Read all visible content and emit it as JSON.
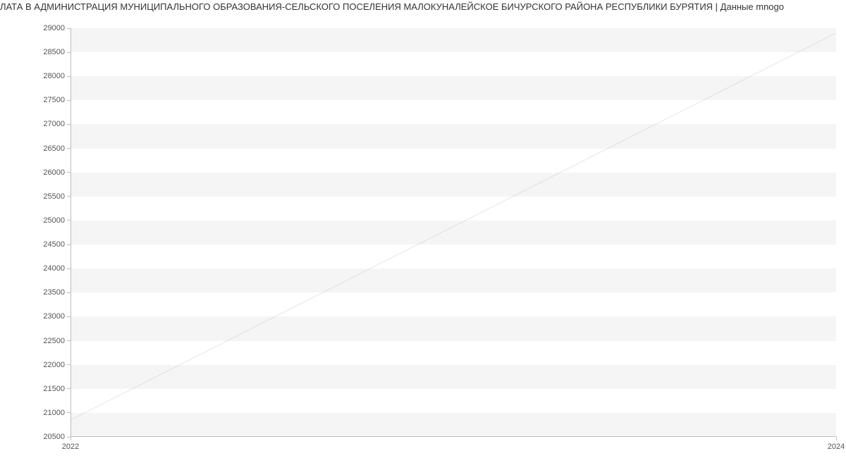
{
  "title": "ЛАТА В АДМИНИСТРАЦИЯ МУНИЦИПАЛЬНОГО ОБРАЗОВАНИЯ-СЕЛЬСКОГО ПОСЕЛЕНИЯ МАЛОКУНАЛЕЙСКОЕ БИЧУРСКОГО РАЙОНА РЕСПУБЛИКИ БУРЯТИЯ | Данные mnogo",
  "chart_data": {
    "type": "line",
    "x": [
      2022,
      2024
    ],
    "values": [
      20850,
      28900
    ],
    "title": "ЛАТА В АДМИНИСТРАЦИЯ МУНИЦИПАЛЬНОГО ОБРАЗОВАНИЯ-СЕЛЬСКОГО ПОСЕЛЕНИЯ МАЛОКУНАЛЕЙСКОЕ БИЧУРСКОГО РАЙОНА РЕСПУБЛИКИ БУРЯТИЯ | Данные mnogo",
    "xlabel": "",
    "ylabel": "",
    "ylim": [
      20500,
      29000
    ],
    "xlim": [
      2022,
      2024
    ],
    "y_ticks": [
      20500,
      21000,
      21500,
      22000,
      22500,
      23000,
      23500,
      24000,
      24500,
      25000,
      25500,
      26000,
      26500,
      27000,
      27500,
      28000,
      28500,
      29000
    ],
    "x_ticks": [
      2022,
      2024
    ],
    "line_color": "#6e95d8"
  }
}
